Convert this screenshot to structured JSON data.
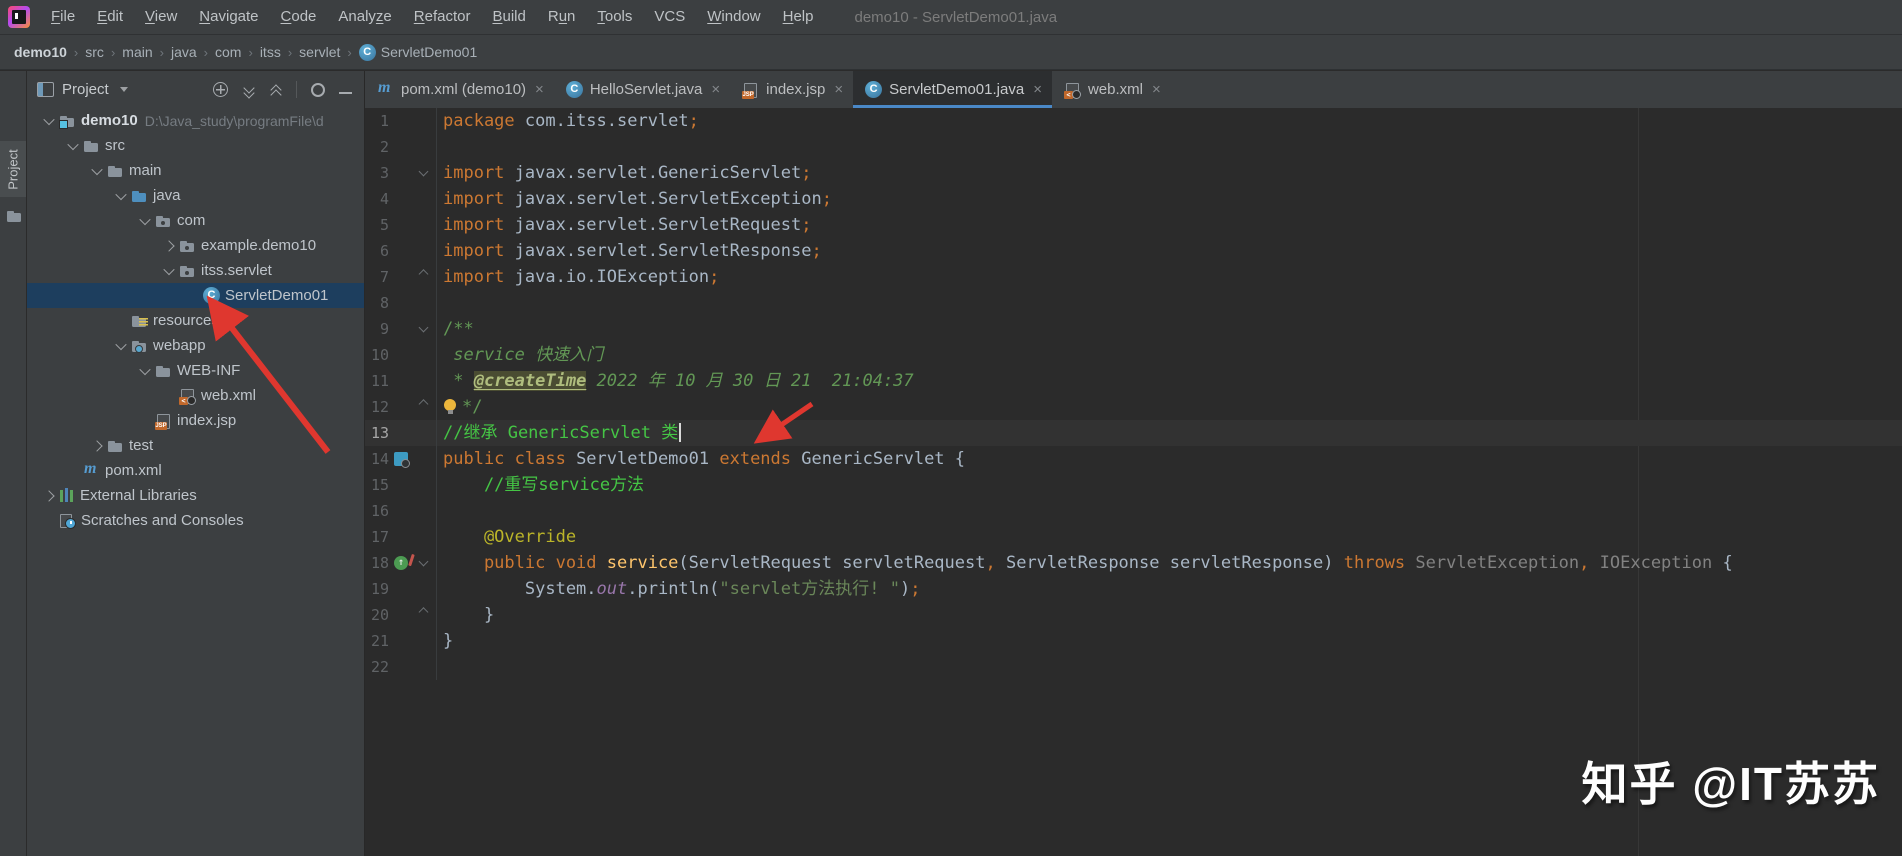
{
  "window": {
    "title": "demo10 - ServletDemo01.java"
  },
  "menu": {
    "items": [
      {
        "label": "File",
        "u": 0
      },
      {
        "label": "Edit",
        "u": 0
      },
      {
        "label": "View",
        "u": 0
      },
      {
        "label": "Navigate",
        "u": 0
      },
      {
        "label": "Code",
        "u": 0
      },
      {
        "label": "Analyze",
        "u": 5
      },
      {
        "label": "Refactor",
        "u": 0
      },
      {
        "label": "Build",
        "u": 0
      },
      {
        "label": "Run",
        "u": 1
      },
      {
        "label": "Tools",
        "u": 0
      },
      {
        "label": "VCS",
        "u": -1
      },
      {
        "label": "Window",
        "u": 0
      },
      {
        "label": "Help",
        "u": 0
      }
    ]
  },
  "breadcrumbs": {
    "separator": "›",
    "items": [
      "demo10",
      "src",
      "main",
      "java",
      "com",
      "itss",
      "servlet",
      "ServletDemo01"
    ]
  },
  "stripe": {
    "project_label": "Project"
  },
  "project_panel": {
    "title": "Project",
    "tree": [
      {
        "depth": 0,
        "chevron": "v",
        "icon": "module-folder",
        "label": "demo10",
        "extra": "D:\\Java_study\\programFile\\d",
        "bold": true
      },
      {
        "depth": 1,
        "chevron": "v",
        "icon": "folder",
        "label": "src"
      },
      {
        "depth": 2,
        "chevron": "v",
        "icon": "folder",
        "label": "main"
      },
      {
        "depth": 3,
        "chevron": "v",
        "icon": "source-folder",
        "label": "java"
      },
      {
        "depth": 4,
        "chevron": "v",
        "icon": "package",
        "label": "com"
      },
      {
        "depth": 5,
        "chevron": ">",
        "icon": "package",
        "label": "example.demo10"
      },
      {
        "depth": 5,
        "chevron": "v",
        "icon": "package",
        "label": "itss.servlet"
      },
      {
        "depth": 6,
        "chevron": "",
        "icon": "class",
        "label": "ServletDemo01",
        "selected": true
      },
      {
        "depth": 3,
        "chevron": "",
        "icon": "resources-folder",
        "label": "resources"
      },
      {
        "depth": 3,
        "chevron": "v",
        "icon": "webapp-folder",
        "label": "webapp"
      },
      {
        "depth": 4,
        "chevron": "v",
        "icon": "folder",
        "label": "WEB-INF"
      },
      {
        "depth": 5,
        "chevron": "",
        "icon": "webxml-file",
        "label": "web.xml"
      },
      {
        "depth": 4,
        "chevron": "",
        "icon": "jsp-file",
        "label": "index.jsp"
      },
      {
        "depth": 2,
        "chevron": ">",
        "icon": "folder",
        "label": "test"
      },
      {
        "depth": 1,
        "chevron": "",
        "icon": "maven",
        "label": "pom.xml"
      },
      {
        "depth": 0,
        "chevron": ">",
        "icon": "libraries",
        "label": "External Libraries"
      },
      {
        "depth": 0,
        "chevron": "",
        "icon": "scratches",
        "label": "Scratches and Consoles"
      }
    ]
  },
  "tabs": [
    {
      "icon": "maven",
      "label": "pom.xml (demo10)",
      "close": "×"
    },
    {
      "icon": "class",
      "label": "HelloServlet.java",
      "close": "×"
    },
    {
      "icon": "jsp-file",
      "label": "index.jsp",
      "close": "×"
    },
    {
      "icon": "class",
      "label": "ServletDemo01.java",
      "close": "×",
      "active": true
    },
    {
      "icon": "webxml-file",
      "label": "web.xml",
      "close": "×"
    }
  ],
  "editor": {
    "lines": [
      {
        "n": 1,
        "spans": [
          {
            "t": "package ",
            "c": "kw"
          },
          {
            "t": "com.itss.servlet",
            "c": "pl"
          },
          {
            "t": ";",
            "c": "kw"
          }
        ]
      },
      {
        "n": 2,
        "spans": []
      },
      {
        "n": 3,
        "fold": "v",
        "spans": [
          {
            "t": "import ",
            "c": "kw"
          },
          {
            "t": "javax.servlet.GenericServlet",
            "c": "pl"
          },
          {
            "t": ";",
            "c": "kw"
          }
        ]
      },
      {
        "n": 4,
        "spans": [
          {
            "t": "import ",
            "c": "kw"
          },
          {
            "t": "javax.servlet.ServletException",
            "c": "pl"
          },
          {
            "t": ";",
            "c": "kw"
          }
        ]
      },
      {
        "n": 5,
        "spans": [
          {
            "t": "import ",
            "c": "kw"
          },
          {
            "t": "javax.servlet.ServletRequest",
            "c": "pl"
          },
          {
            "t": ";",
            "c": "kw"
          }
        ]
      },
      {
        "n": 6,
        "spans": [
          {
            "t": "import ",
            "c": "kw"
          },
          {
            "t": "javax.servlet.ServletResponse",
            "c": "pl"
          },
          {
            "t": ";",
            "c": "kw"
          }
        ]
      },
      {
        "n": 7,
        "fold": "u",
        "spans": [
          {
            "t": "import ",
            "c": "kw"
          },
          {
            "t": "java.io.IOException",
            "c": "pl"
          },
          {
            "t": ";",
            "c": "kw"
          }
        ]
      },
      {
        "n": 8,
        "spans": []
      },
      {
        "n": 9,
        "fold": "v",
        "spans": [
          {
            "t": "/**",
            "c": "jdm"
          }
        ]
      },
      {
        "n": 10,
        "spans": [
          {
            "t": " service 快速入门",
            "c": "jd"
          }
        ]
      },
      {
        "n": 11,
        "spans": [
          {
            "t": " * ",
            "c": "jd"
          },
          {
            "t": "@createTime",
            "c": "tag"
          },
          {
            "t": " 2022 年 10 月 30 日 21  21:04:37",
            "c": "jd"
          }
        ]
      },
      {
        "n": 12,
        "fold": "u",
        "bulb": true,
        "spans": [
          {
            "t": "*/",
            "c": "jdm"
          }
        ]
      },
      {
        "n": 13,
        "caret": true,
        "spans": [
          {
            "t": "//继承 GenericServlet 类",
            "c": "cm"
          }
        ]
      },
      {
        "n": 14,
        "gicon": "class-marker",
        "spans": [
          {
            "t": "public class ",
            "c": "kw"
          },
          {
            "t": "ServletDemo01 ",
            "c": "pl"
          },
          {
            "t": "extends ",
            "c": "kw"
          },
          {
            "t": "GenericServlet {",
            "c": "pl"
          }
        ]
      },
      {
        "n": 15,
        "spans": [
          {
            "t": "    //重写service方法",
            "c": "cm"
          }
        ]
      },
      {
        "n": 16,
        "spans": []
      },
      {
        "n": 17,
        "spans": [
          {
            "t": "    @Override",
            "c": "ann"
          }
        ]
      },
      {
        "n": 18,
        "gicon": "override-marker",
        "fold": "v",
        "spans": [
          {
            "t": "    public void ",
            "c": "kw"
          },
          {
            "t": "service",
            "c": "mth"
          },
          {
            "t": "(",
            "c": "pl"
          },
          {
            "t": "ServletRequest servletRequest",
            "c": "pl"
          },
          {
            "t": ",",
            "c": "kw"
          },
          {
            "t": " ServletResponse servletResponse",
            "c": "pl"
          },
          {
            "t": ") ",
            "c": "pl"
          },
          {
            "t": "throws ",
            "c": "kw"
          },
          {
            "t": "ServletException",
            "c": "dim"
          },
          {
            "t": ",",
            "c": "kw"
          },
          {
            "t": " IOException",
            "c": "dim"
          },
          {
            "t": " {",
            "c": "pl"
          }
        ]
      },
      {
        "n": 19,
        "spans": [
          {
            "t": "        System.",
            "c": "pl"
          },
          {
            "t": "out",
            "c": "fld"
          },
          {
            "t": ".println(",
            "c": "pl"
          },
          {
            "t": "\"servlet方法执行! \"",
            "c": "str"
          },
          {
            "t": ")",
            "c": "pl"
          },
          {
            "t": ";",
            "c": "kw"
          }
        ]
      },
      {
        "n": 20,
        "fold": "u",
        "spans": [
          {
            "t": "    }",
            "c": "pl"
          }
        ]
      },
      {
        "n": 21,
        "spans": [
          {
            "t": "}",
            "c": "pl"
          }
        ]
      },
      {
        "n": 22,
        "spans": []
      }
    ]
  },
  "watermark": {
    "text": "知乎 @IT苏苏"
  },
  "colors": {
    "chrome_bg": "#3C3F41",
    "editor_bg": "#2B2B2B",
    "accent": "#4A88C7",
    "selection": "#1D3E5E",
    "keyword": "#CC7832",
    "plain": "#A9B7C6",
    "comment": "#45C545",
    "javadoc": "#629755",
    "doc_tag": "#AFBD7E",
    "annotation": "#BBB529",
    "string": "#6A8759",
    "field": "#9876AA",
    "method": "#FFC66D",
    "dim": "#828282",
    "line_number": "#606366",
    "arrow": "#DF372F"
  }
}
